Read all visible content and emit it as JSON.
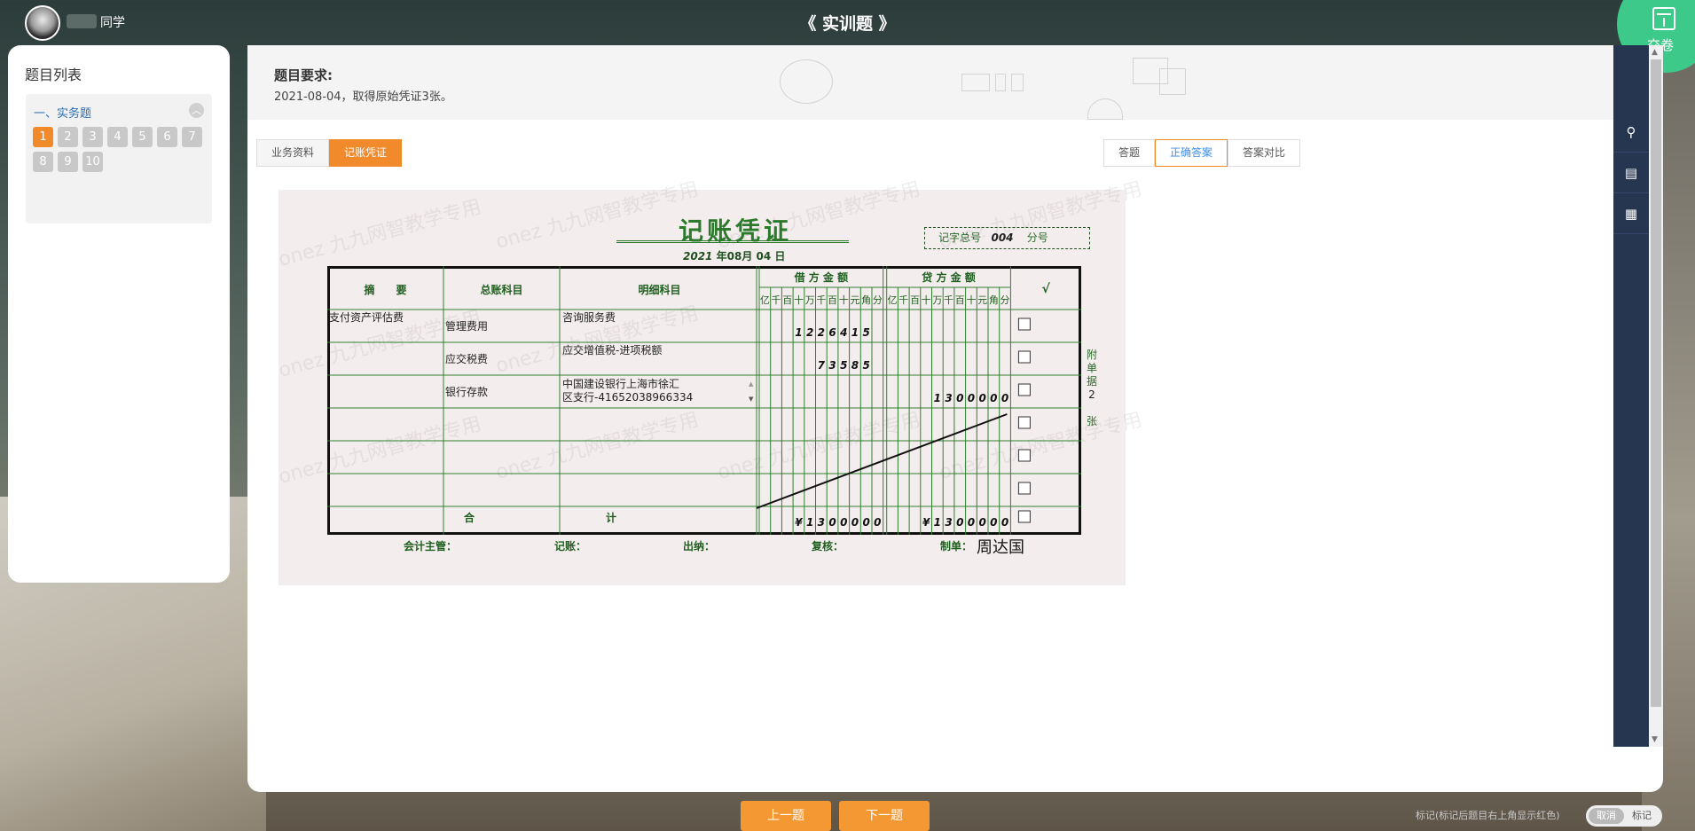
{
  "header": {
    "user_suffix": "同学",
    "title": "《 实训题 》",
    "submit_label": "交卷"
  },
  "question_list": {
    "title": "题目列表",
    "section_name": "一、实务题",
    "numbers": [
      "1",
      "2",
      "3",
      "4",
      "5",
      "6",
      "7",
      "8",
      "9",
      "10"
    ],
    "active_number": "1"
  },
  "requirement": {
    "title": "题目要求:",
    "text": "2021-08-04，取得原始凭证3张。"
  },
  "tabs_left": [
    {
      "label": "业务资料",
      "active": false
    },
    {
      "label": "记账凭证",
      "active": true
    }
  ],
  "tabs_right": [
    {
      "label": "答题",
      "active": false
    },
    {
      "label": "正确答案",
      "active": true
    },
    {
      "label": "答案对比",
      "active": false
    }
  ],
  "voucher": {
    "title": "记账凭证",
    "date_year": "2021",
    "date_year_label": "年",
    "date_month": "08",
    "date_month_label": "月",
    "date_day": "04",
    "date_day_label": "日",
    "number_prefix": "记字总号",
    "number_value": "004",
    "number_suffix": "分号",
    "headers": {
      "summary": "摘　　要",
      "general_account": "总账科目",
      "detail_account": "明细科目",
      "debit": "借 方 金 额",
      "credit": "贷 方 金 额",
      "check": "√"
    },
    "digit_units": [
      "亿",
      "千",
      "百",
      "十",
      "万",
      "千",
      "百",
      "十",
      "元",
      "角",
      "分"
    ],
    "rows": [
      {
        "summary": "支付资产评估费",
        "general": "管理费用",
        "detail": "咨询服务费",
        "debit": "122641 5",
        "debit_digits": [
          "",
          "",
          "",
          "1",
          "2",
          "2",
          "6",
          "4",
          "1",
          "5",
          ""
        ],
        "credit_digits": [
          "",
          "",
          "",
          "",
          "",
          "",
          "",
          "",
          "",
          "",
          ""
        ]
      },
      {
        "summary": "",
        "general": "应交税费",
        "detail": "应交增值税-进项税额",
        "debit_digits": [
          "",
          "",
          "",
          "",
          "",
          "7",
          "3",
          "5",
          "8",
          "5",
          ""
        ],
        "credit_digits": [
          "",
          "",
          "",
          "",
          "",
          "",
          "",
          "",
          "",
          "",
          ""
        ]
      },
      {
        "summary": "",
        "general": "银行存款",
        "detail": "中国建设银行上海市徐汇区支行-41652038966334",
        "debit_digits": [
          "",
          "",
          "",
          "",
          "",
          "",
          "",
          "",
          "",
          "",
          ""
        ],
        "credit_digits": [
          "",
          "",
          "",
          "",
          "1",
          "3",
          "0",
          "0",
          "0",
          "0",
          "0"
        ]
      },
      {
        "summary": "",
        "general": "",
        "detail": "",
        "debit_digits": [
          "",
          "",
          "",
          "",
          "",
          "",
          "",
          "",
          "",
          "",
          ""
        ],
        "credit_digits": [
          "",
          "",
          "",
          "",
          "",
          "",
          "",
          "",
          "",
          "",
          ""
        ]
      },
      {
        "summary": "",
        "general": "",
        "detail": "",
        "debit_digits": [
          "",
          "",
          "",
          "",
          "",
          "",
          "",
          "",
          "",
          "",
          ""
        ],
        "credit_digits": [
          "",
          "",
          "",
          "",
          "",
          "",
          "",
          "",
          "",
          "",
          ""
        ]
      },
      {
        "summary": "",
        "general": "",
        "detail": "",
        "debit_digits": [
          "",
          "",
          "",
          "",
          "",
          "",
          "",
          "",
          "",
          "",
          ""
        ],
        "credit_digits": [
          "",
          "",
          "",
          "",
          "",
          "",
          "",
          "",
          "",
          "",
          ""
        ]
      }
    ],
    "total_label_left": "合",
    "total_label_right": "计",
    "total_debit_digits": [
      "",
      "",
      "",
      "¥",
      "1",
      "3",
      "0",
      "0",
      "0",
      "0",
      "0"
    ],
    "total_credit_digits": [
      "",
      "",
      "",
      "¥",
      "1",
      "3",
      "0",
      "0",
      "0",
      "0",
      "0"
    ],
    "attachment_label": "附单据",
    "attachment_count": "2",
    "attachment_unit": "张",
    "footer": {
      "supervisor": "会计主管：",
      "bookkeeper": "记账：",
      "cashier": "出纳：",
      "reviewer": "复核：",
      "maker": "制单：",
      "maker_name": "周达国"
    },
    "watermark": "onez 九九网智教学专用"
  },
  "nav": {
    "prev_label": "上一题",
    "next_label": "下一题",
    "mark_hint": "标记(标记后题目右上角显示红色)",
    "cancel_label": "取消",
    "mark_label": "标记"
  },
  "colors": {
    "accent": "#f08a2b",
    "submit": "#3cc98a",
    "sidebar": "#263650",
    "voucher_green": "#2b7a2b"
  }
}
